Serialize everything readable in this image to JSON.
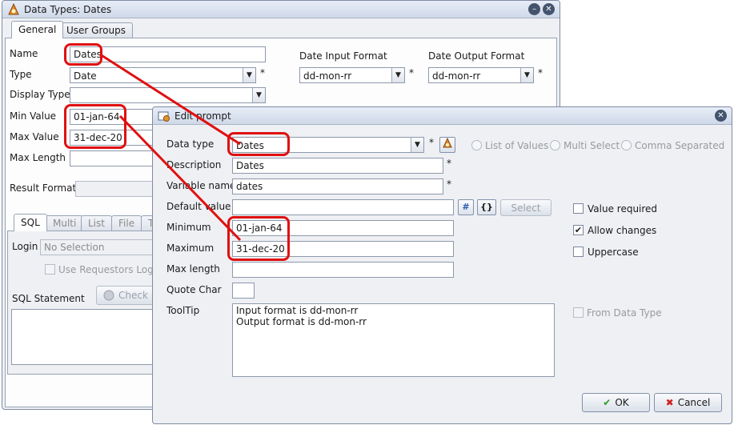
{
  "main_window": {
    "title": "Data Types: Dates",
    "tabs": [
      "General",
      "User Groups"
    ],
    "labels": {
      "name": "Name",
      "type": "Type",
      "display_type": "Display Type",
      "min_value": "Min Value",
      "max_value": "Max Value",
      "max_length": "Max Length",
      "result_format": "Result Format",
      "date_input_format": "Date Input Format",
      "date_output_format": "Date Output Format",
      "login": "Login",
      "sql_statement": "SQL Statement"
    },
    "values": {
      "name": "Dates",
      "type": "Date",
      "display_type": "",
      "min_value": "01-jan-64",
      "max_value": "31-dec-20",
      "max_length": "",
      "date_input_format": "dd-mon-rr",
      "date_output_format": "dd-mon-rr",
      "login": "No Selection"
    },
    "required_mark": "*",
    "sub_tabs": [
      "SQL",
      "Multi",
      "List",
      "File",
      "T"
    ],
    "use_requestors_login": "Use Requestors Login",
    "check_button": "Check"
  },
  "edit_prompt": {
    "title": "Edit prompt",
    "labels": {
      "data_type": "Data type",
      "description": "Description",
      "variable_name": "Variable name",
      "default_value": "Default value",
      "minimum": "Minimum",
      "maximum": "Maximum",
      "max_length": "Max length",
      "quote_char": "Quote Char",
      "tooltip": "ToolTip"
    },
    "values": {
      "data_type": "Dates",
      "description": "Dates",
      "variable_name": "dates",
      "default_value": "",
      "minimum": "01-jan-64",
      "maximum": "31-dec-20",
      "max_length": "",
      "quote_char": "",
      "tooltip": "Input format is dd-mon-rr\nOutput format is dd-mon-rr"
    },
    "radio_options": [
      "List of Values",
      "Multi Select",
      "Comma Separated"
    ],
    "checkboxes": [
      {
        "label": "Value required",
        "checked": false
      },
      {
        "label": "Allow changes",
        "checked": true
      },
      {
        "label": "Uppercase",
        "checked": false
      }
    ],
    "from_data_type": "From Data Type",
    "select_button": "Select",
    "ok_button": "OK",
    "cancel_button": "Cancel",
    "braces_button": "{}"
  },
  "colors": {
    "highlight": "#e01010",
    "window_bg": "#eef0f4",
    "titlebar": "#d6dfec"
  },
  "icons": [
    "app-icon",
    "minimize-icon",
    "close-icon",
    "cancel-icon",
    "check-icon",
    "hash-icon",
    "data-type-edit-icon",
    "prompt-icon"
  ]
}
